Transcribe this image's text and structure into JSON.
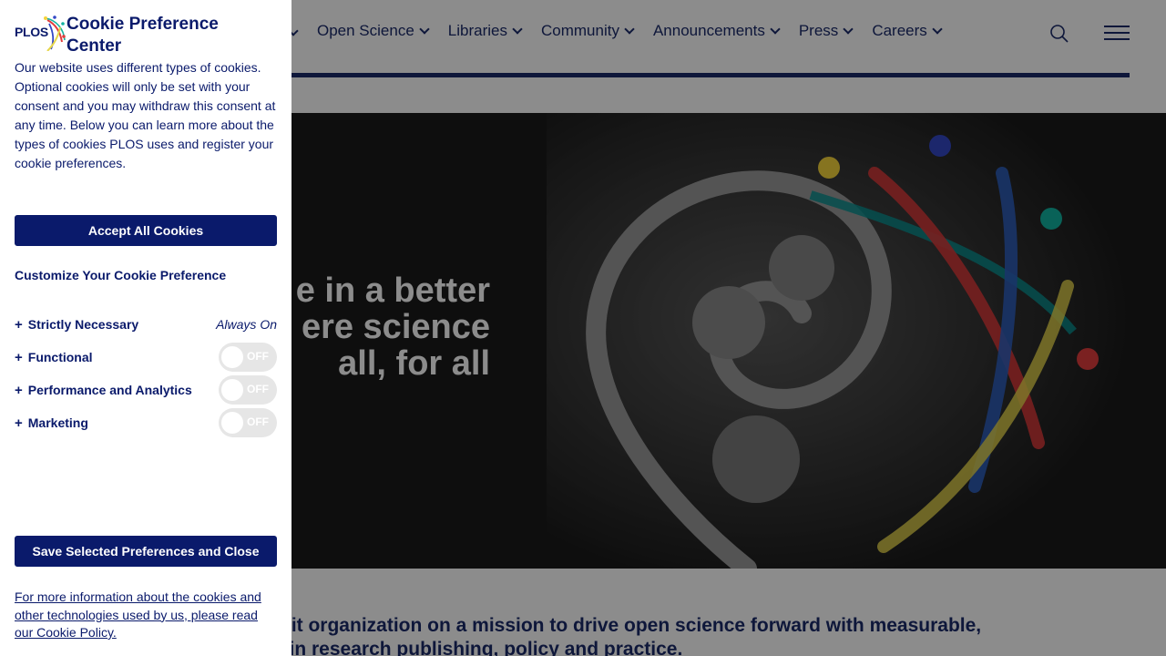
{
  "nav": {
    "items": [
      {
        "label": "Open Science"
      },
      {
        "label": "Libraries"
      },
      {
        "label": "Community"
      },
      {
        "label": "Announcements"
      },
      {
        "label": "Press"
      },
      {
        "label": "Careers"
      }
    ],
    "search_icon": "search-icon",
    "menu_icon": "hamburger-menu-icon"
  },
  "hero": {
    "line1": "e in a better",
    "line2": "ere science",
    "line3": "all, for all"
  },
  "mission": {
    "line1": "ofit organization on a mission to drive open science forward with measurable,",
    "line2": "e in research publishing, policy and practice."
  },
  "cookie_panel": {
    "logo_text": "PLOS",
    "title": "Cookie Preference Center",
    "description": "Our website uses different types of cookies. Optional cookies will only be set with your consent and you may withdraw this consent at any time. Below you can learn more about the types of cookies PLOS uses and register your cookie preferences.",
    "accept_all_label": "Accept All Cookies",
    "customize_title": "Customize Your Cookie Preference",
    "preferences": [
      {
        "label": "Strictly Necessary",
        "status": "Always On"
      },
      {
        "label": "Functional",
        "toggle": "OFF"
      },
      {
        "label": "Performance and Analytics",
        "toggle": "OFF"
      },
      {
        "label": "Marketing",
        "toggle": "OFF"
      }
    ],
    "save_label": "Save Selected Preferences and Close",
    "policy_link": "For more information about the cookies and other technologies used by us, please read our Cookie Policy."
  },
  "colors": {
    "brand_navy": "#0a1a6b",
    "nav_text": "#1b2a6b",
    "toggle_off": "#e6e6e6"
  }
}
